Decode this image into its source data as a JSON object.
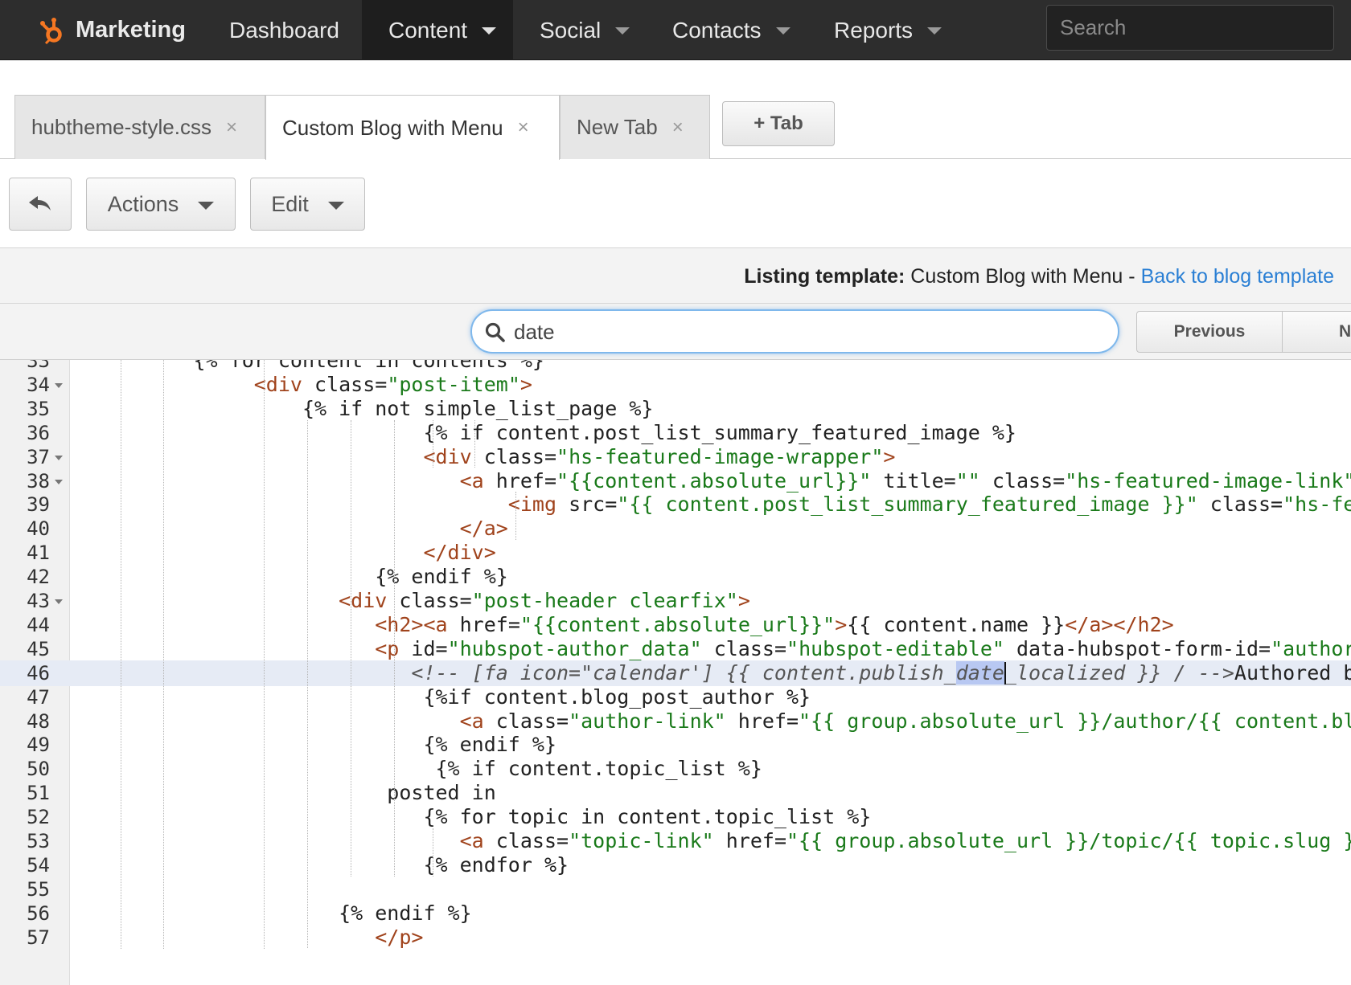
{
  "nav": {
    "brand": "Marketing",
    "items": [
      {
        "label": "Dashboard",
        "dropdown": false,
        "active": false
      },
      {
        "label": "Content",
        "dropdown": true,
        "active": true
      },
      {
        "label": "Social",
        "dropdown": true,
        "active": false
      },
      {
        "label": "Contacts",
        "dropdown": true,
        "active": false
      },
      {
        "label": "Reports",
        "dropdown": true,
        "active": false
      }
    ],
    "search_placeholder": "Search"
  },
  "tabs": [
    {
      "label": "hubtheme-style.css",
      "close": "×",
      "active": false
    },
    {
      "label": "Custom Blog with Menu",
      "close": "×",
      "active": true
    },
    {
      "label": "New Tab",
      "close": "×",
      "active": false
    }
  ],
  "add_tab_label": "+ Tab",
  "toolbar": {
    "actions_label": "Actions",
    "edit_label": "Edit"
  },
  "listing": {
    "prefix": "Listing template:",
    "name": "Custom Blog with Menu -",
    "back_link": "Back to blog template"
  },
  "find": {
    "query": "date",
    "previous_label": "Previous",
    "next_label": "Next"
  },
  "editor": {
    "cursor_line": 46,
    "lines": [
      {
        "n": "33",
        "t": "{% for content in contents %}"
      },
      {
        "n": "34",
        "t": "<div class=\"post-item\">",
        "fold": true
      },
      {
        "n": "35",
        "t": "{% if not simple_list_page %}"
      },
      {
        "n": "36",
        "t": "{% if content.post_list_summary_featured_image %}"
      },
      {
        "n": "37",
        "t": "<div class=\"hs-featured-image-wrapper\">",
        "fold": true
      },
      {
        "n": "38",
        "t": "<a href=\"{{content.absolute_url}}\" title=\"\" class=\"hs-featured-image-link\"",
        "fold": true
      },
      {
        "n": "39",
        "t": "<img src=\"{{ content.post_list_summary_featured_image }}\" class=\"hs-fe"
      },
      {
        "n": "40",
        "t": "</a>"
      },
      {
        "n": "41",
        "t": "</div>"
      },
      {
        "n": "42",
        "t": "{% endif %}"
      },
      {
        "n": "43",
        "t": "<div class=\"post-header clearfix\">",
        "fold": true
      },
      {
        "n": "44",
        "t": "<h2><a href=\"{{content.absolute_url}}\">{{ content.name }}</a></h2>"
      },
      {
        "n": "45",
        "t": "<p id=\"hubspot-author_data\" class=\"hubspot-editable\" data-hubspot-form-id=\"author_"
      },
      {
        "n": "46",
        "t": "<!-- [fa icon=\"calendar'] {{ content.publish_date_localized }} / -->Authored by"
      },
      {
        "n": "47",
        "t": "{%if content.blog_post_author %}"
      },
      {
        "n": "48",
        "t": "<a class=\"author-link\" href=\"{{ group.absolute_url }}/author/{{ content.bl"
      },
      {
        "n": "49",
        "t": "{% endif %}"
      },
      {
        "n": "50",
        "t": "{% if content.topic_list %}"
      },
      {
        "n": "51",
        "t": "posted in"
      },
      {
        "n": "52",
        "t": "{% for topic in content.topic_list %}"
      },
      {
        "n": "53",
        "t": "<a class=\"topic-link\" href=\"{{ group.absolute_url }}/topic/{{ topic.slug }"
      },
      {
        "n": "54",
        "t": "{% endfor %}"
      },
      {
        "n": "55",
        "t": ""
      },
      {
        "n": "56",
        "t": "{% endif %}"
      },
      {
        "n": "57",
        "t": "</p>"
      }
    ]
  },
  "colors": {
    "nav_bg": "#2d2d2d",
    "tag": "#a0431c",
    "string": "#1a7a1a",
    "link": "#2a7fd4",
    "highlight_line": "#e6ebf5",
    "match": "#b8c8f2",
    "brand_logo": "#f57722"
  },
  "icons": {
    "logo": "hubspot-sprocket-icon",
    "back": "undo-arrow-icon",
    "find": "magnifier-icon",
    "dropdown": "caret-down-icon",
    "tab_close": "close-icon"
  }
}
